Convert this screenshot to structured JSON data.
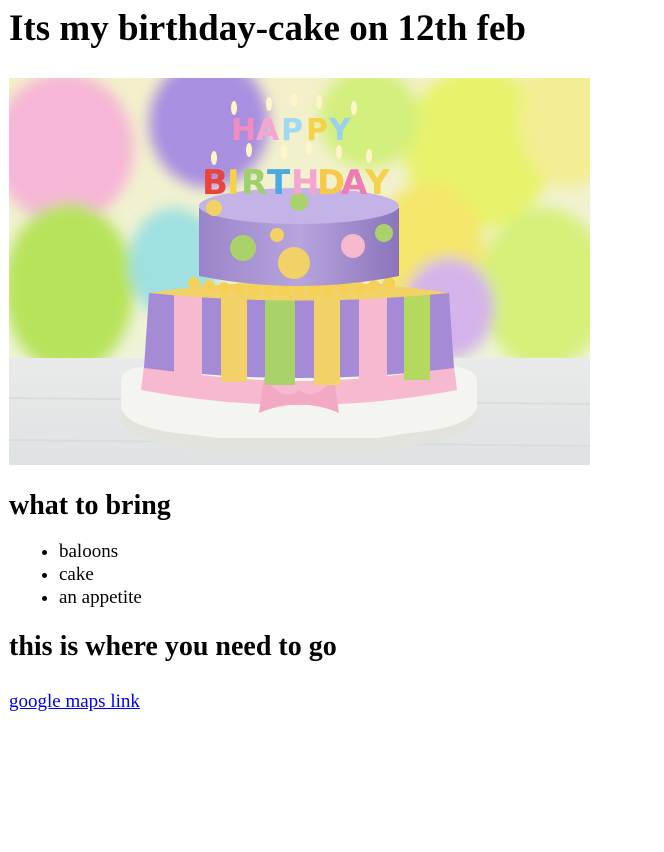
{
  "heading": "Its my birthday-cake on 12th feb",
  "image": {
    "subject": "two-tier birthday cake with candles"
  },
  "bring_section": {
    "heading": "what to bring",
    "items": [
      "baloons",
      "cake",
      "an appetite"
    ]
  },
  "location_section": {
    "heading": "this is where you need to go",
    "link_text": "google maps link"
  },
  "colors": {
    "link": "#0000ee"
  }
}
